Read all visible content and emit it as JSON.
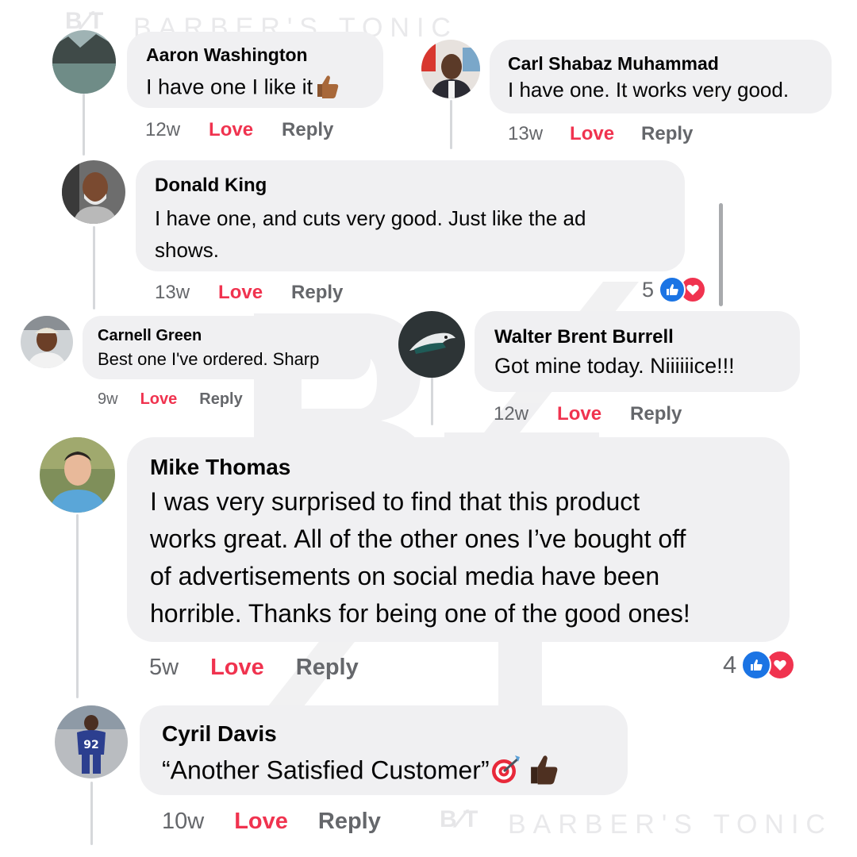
{
  "watermark": {
    "brand": "BARBER'S TONIC",
    "logo": "BT"
  },
  "actions": {
    "love": "Love",
    "reply": "Reply"
  },
  "colors": {
    "bubble": "#f0f0f2",
    "love": "#f0334f",
    "like_blue": "#1b74e4",
    "meta_gray": "#65676b"
  },
  "comments": [
    {
      "name": "Aaron Washington",
      "lines": [
        "I have one I like it"
      ],
      "emoji": [
        "thumbs-up-icon"
      ],
      "time": "12w"
    },
    {
      "name": "Carl Shabaz Muhammad",
      "lines": [
        "I have one. It works very good."
      ],
      "time": "13w"
    },
    {
      "name": "Donald King",
      "lines": [
        "I have one, and cuts very good. Just like the ad",
        "shows."
      ],
      "time": "13w",
      "reaction_count": "5",
      "reactions": [
        "like-icon",
        "love-icon"
      ]
    },
    {
      "name": "Carnell Green",
      "lines": [
        "Best one I've ordered. Sharp"
      ],
      "time": "9w"
    },
    {
      "name": "Walter Brent Burrell",
      "lines": [
        "Got mine today.  Niiiiiice!!!"
      ],
      "time": "12w"
    },
    {
      "name": "Mike Thomas",
      "lines": [
        "I was very surprised to find that this product",
        "works great. All of the other ones I’ve bought off",
        "of advertisements on social media have been",
        "horrible. Thanks for being one of the good ones!"
      ],
      "time": "5w",
      "reaction_count": "4",
      "reactions": [
        "like-icon",
        "love-icon"
      ]
    },
    {
      "name": "Cyril Davis",
      "lines": [
        "“Another Satisfied Customer”"
      ],
      "emoji": [
        "bullseye-icon",
        "thumbs-up-icon"
      ],
      "time": "10w"
    }
  ]
}
